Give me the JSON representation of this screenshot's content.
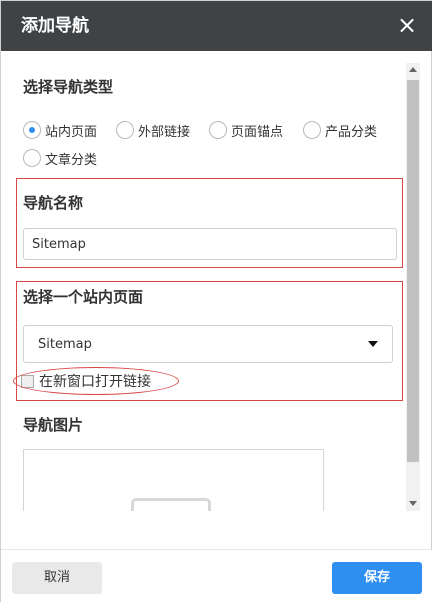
{
  "dialog": {
    "title": "添加导航",
    "close_icon": "close-icon"
  },
  "nav_type": {
    "title": "选择导航类型",
    "options": [
      "站内页面",
      "外部链接",
      "页面锚点",
      "产品分类",
      "文章分类"
    ],
    "selected": "站内页面"
  },
  "nav_name": {
    "title": "导航名称",
    "value": "Sitemap"
  },
  "page_select": {
    "title": "选择一个站内页面",
    "selected": "Sitemap",
    "new_window_label": "在新窗口打开链接"
  },
  "nav_image": {
    "title": "导航图片"
  },
  "footer": {
    "cancel_label": "取消",
    "save_label": "保存"
  },
  "colors": {
    "titlebar": "#3f4346",
    "accent": "#2f8ff0",
    "highlight": "#d94646"
  }
}
